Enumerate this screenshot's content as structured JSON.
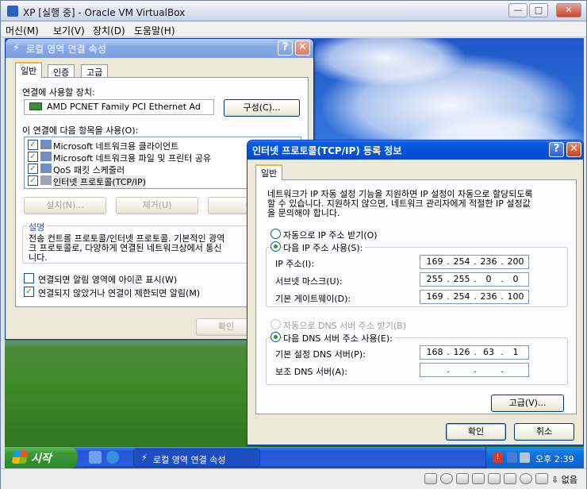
{
  "vbox": {
    "title": "XP [실행 중] - Oracle VM VirtualBox",
    "menu": [
      "머신(M)",
      "보기(V)",
      "장치(D)",
      "도움말(H)"
    ],
    "min": "—",
    "restore": "□",
    "close": "✕"
  },
  "lan_dialog": {
    "title": "로컬 영역 연결 속성",
    "help": "?",
    "close": "✕",
    "tabs": [
      "일반",
      "인증",
      "고급"
    ],
    "device_label": "연결에 사용할 장치:",
    "device_name": "AMD PCNET Family PCI Ethernet Ad",
    "configure_btn": "구성(C)...",
    "items_label": "이 연결에 다음 항목을 사용(O):",
    "items": [
      "Microsoft 네트워크용 클라이언트",
      "Microsoft 네트워크용 파일 및 프린터 공유",
      "QoS 패킷 스케줄러",
      "인터넷 프로토콜(TCP/IP)"
    ],
    "install_btn": "설치(N)...",
    "remove_btn": "제거(U)",
    "props_btn": "속",
    "desc_title": "설명",
    "desc_text_1": "전송 컨트롤 프로토콜/인터넷 프로토콜. 기본적인 광역",
    "desc_text_2": "크 프로토콜로, 다양하게 연결된 네트워크상에서 통신",
    "desc_text_3": "니다.",
    "show_icon_label": "연결되면 알림 영역에 아이콘 표시(W)",
    "notify_label": "연결되지 않았거나 연결이 제한되면 알림(M)",
    "ok_btn": "확인",
    "cancel_btn": "취"
  },
  "tcpip_dialog": {
    "title": "인터넷 프로토콜(TCP/IP) 등록 정보",
    "help": "?",
    "close": "✕",
    "tab": "일반",
    "info_1": "네트워크가 IP 자동 설정 기능을 지원하면 IP 설정이 자동으로 할당되도록",
    "info_2": "할 수 있습니다. 지원하지 않으면, 네트워크 관리자에게 적절한 IP 설정값",
    "info_3": "을 문의해야 합니다.",
    "auto_ip": "자동으로 IP 주소 받기(O)",
    "manual_ip": "다음 IP 주소 사용(S):",
    "ip_label": "IP 주소(I):",
    "ip": [
      "169",
      "254",
      "236",
      "200"
    ],
    "mask_label": "서브넷 마스크(U):",
    "mask": [
      "255",
      "255",
      "0",
      "0"
    ],
    "gateway_label": "기본 게이트웨이(D):",
    "gateway": [
      "169",
      "254",
      "236",
      "100"
    ],
    "auto_dns": "자동으로 DNS 서버 주소 받기(B)",
    "manual_dns": "다음 DNS 서버 주소 사용(E):",
    "dns1_label": "기본 설정 DNS 서버(P):",
    "dns1": [
      "168",
      "126",
      "63",
      "1"
    ],
    "dns2_label": "보조 DNS 서버(A):",
    "dns2": [
      "",
      "",
      "",
      ""
    ],
    "advanced_btn": "고급(V)...",
    "ok_btn": "확인",
    "cancel_btn": "취소"
  },
  "taskbar": {
    "start": "시작",
    "task_item": "로컬 영역 연결 속성",
    "clock": "오후 2:39"
  },
  "status": {
    "host_key": "⇩ 없음"
  },
  "colors": {
    "xp_blue": "#0452d8",
    "start_green": "#3b9a37",
    "check_green": "#21a121"
  }
}
